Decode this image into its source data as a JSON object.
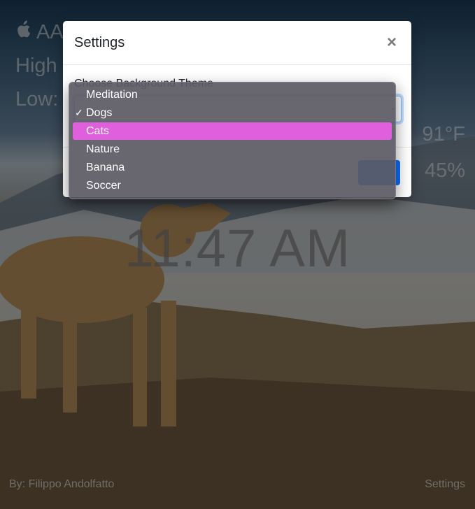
{
  "weather": {
    "ticker_partial": "AAPL",
    "high_label_partial": "High",
    "low_label_partial": "Low:",
    "temperature_partial": "91°F",
    "humidity_partial": "45%"
  },
  "clock": {
    "time": "11:47 AM"
  },
  "footer": {
    "credit": "By: Filippo Andolfatto",
    "settings_link": "Settings"
  },
  "modal": {
    "title": "Settings",
    "close_symbol": "×",
    "field_label_partial": "Choose Background Theme"
  },
  "dropdown": {
    "options": [
      {
        "label": "Meditation",
        "checked": false,
        "highlighted": false
      },
      {
        "label": "Dogs",
        "checked": true,
        "highlighted": false
      },
      {
        "label": "Cats",
        "checked": false,
        "highlighted": true
      },
      {
        "label": "Nature",
        "checked": false,
        "highlighted": false
      },
      {
        "label": "Banana",
        "checked": false,
        "highlighted": false
      },
      {
        "label": "Soccer",
        "checked": false,
        "highlighted": false
      }
    ],
    "check_mark": "✓",
    "highlight_color": "#e05fdc"
  },
  "icons": {
    "apple": "apple-icon"
  }
}
